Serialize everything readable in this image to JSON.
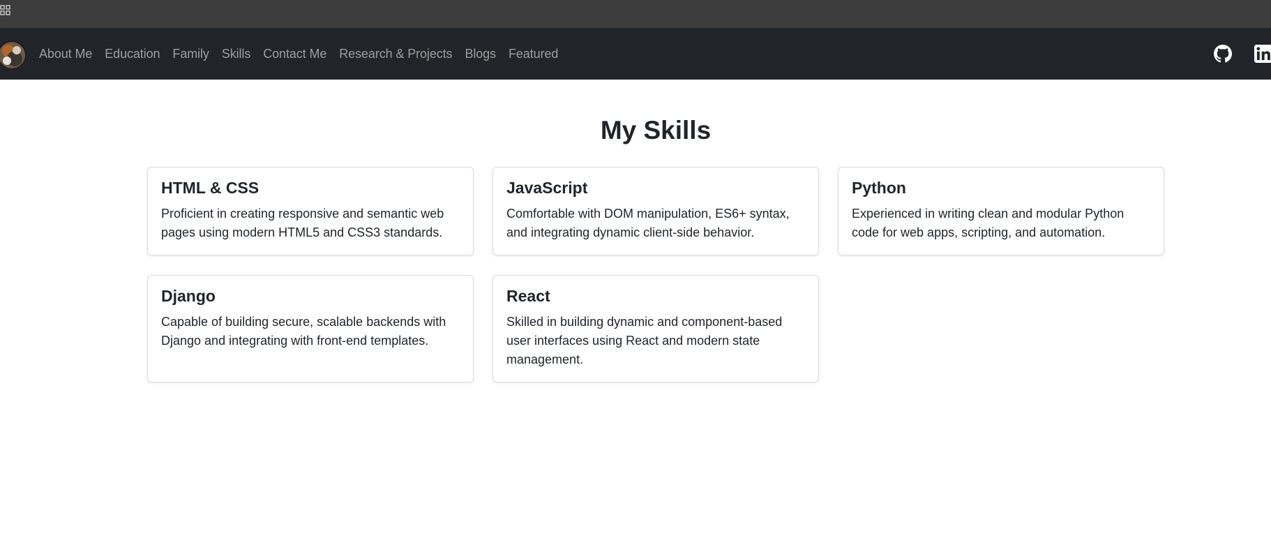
{
  "nav": {
    "items": [
      {
        "label": "About Me"
      },
      {
        "label": "Education"
      },
      {
        "label": "Family"
      },
      {
        "label": "Skills"
      },
      {
        "label": "Contact Me"
      },
      {
        "label": "Research & Projects"
      },
      {
        "label": "Blogs"
      },
      {
        "label": "Featured"
      }
    ],
    "social": [
      {
        "icon": "github-icon"
      },
      {
        "icon": "linkedin-icon"
      }
    ]
  },
  "main": {
    "title": "My Skills",
    "cards": [
      {
        "title": "HTML & CSS",
        "text": "Proficient in creating responsive and semantic web pages using modern HTML5 and CSS3 standards."
      },
      {
        "title": "JavaScript",
        "text": "Comfortable with DOM manipulation, ES6+ syntax, and integrating dynamic client-side behavior."
      },
      {
        "title": "Python",
        "text": "Experienced in writing clean and modular Python code for web apps, scripting, and automation."
      },
      {
        "title": "Django",
        "text": "Capable of building secure, scalable backends with Django and integrating with front-end templates."
      },
      {
        "title": "React",
        "text": "Skilled in building dynamic and component-based user interfaces using React and modern state management."
      }
    ]
  },
  "colors": {
    "navbar": "#212529",
    "topstrip": "#3c3c3c",
    "text": "#212529"
  }
}
